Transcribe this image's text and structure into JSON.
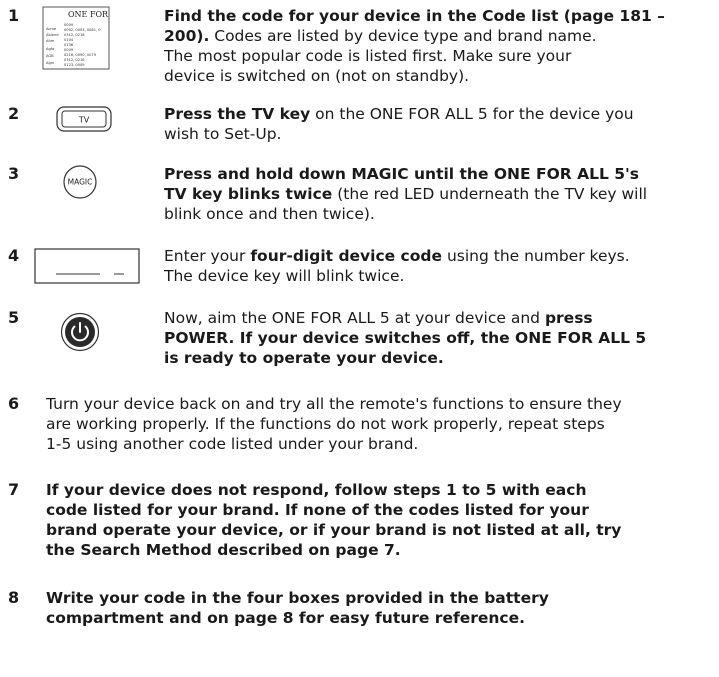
{
  "steps": [
    {
      "number": "1",
      "icon": "code-list-page-thumbnail",
      "thumbnail": {
        "heading": "ONE FOR",
        "brands": [
          "Acme",
          "Abiend",
          "Ahm",
          "Agfa",
          "AGB",
          "Agni"
        ],
        "codes": [
          "0009",
          "0002, 0093, 0081, 0",
          "0312, 0216",
          "0104",
          "0136",
          "0009",
          "0216, 0090, 0079",
          "0312, 0216",
          "0123, 0009"
        ]
      },
      "lines": [
        {
          "b": "Find the code for your device in the Code list (page 181 –"
        },
        {
          "b": "200).",
          "n": " Codes are listed by device type and brand name."
        },
        {
          "n": "The most popular code is listed first. Make sure your"
        },
        {
          "n": "device is switched on (not on standby)."
        }
      ]
    },
    {
      "number": "2",
      "icon": "tv-key-icon",
      "icon_label": "TV",
      "lines": [
        {
          "b": "Press the TV key",
          "n": " on the ONE FOR ALL 5 for the device you"
        },
        {
          "n": "wish to Set-Up."
        }
      ]
    },
    {
      "number": "3",
      "icon": "magic-key-icon",
      "icon_label": "MAGIC",
      "lines": [
        {
          "b": "Press and hold down MAGIC until the ONE FOR ALL 5's"
        },
        {
          "b": "TV key blinks twice",
          "n": " (the red LED underneath the TV key will"
        },
        {
          "n": "blink once and then twice)."
        }
      ]
    },
    {
      "number": "4",
      "icon": "code-entry-box-icon",
      "lines": [
        {
          "n": "Enter your ",
          "b": "four-digit device code",
          "n2": " using the number keys."
        },
        {
          "n": "The device key will blink twice."
        }
      ]
    },
    {
      "number": "5",
      "icon": "power-key-icon",
      "lines": [
        {
          "n": "Now, aim the ONE FOR ALL 5 at your device and ",
          "b": "press"
        },
        {
          "b": "POWER. If your device switches off, the ONE FOR ALL 5"
        },
        {
          "b": "is ready to operate your device."
        }
      ]
    },
    {
      "number": "6",
      "lines": [
        {
          "n": "Turn your device back on and try all the remote's functions to ensure they"
        },
        {
          "n": "are working properly. If the functions do not work properly, repeat steps"
        },
        {
          "n": "1-5 using another code listed under your brand."
        }
      ]
    },
    {
      "number": "7",
      "lines": [
        {
          "b": "If your device does not respond, follow steps 1 to 5 with each"
        },
        {
          "b": "code listed for your brand. If none of the codes listed for your"
        },
        {
          "b": "brand operate your device, or if your brand is not listed at all, try"
        },
        {
          "b": "the Search Method described on page 7."
        }
      ]
    },
    {
      "number": "8",
      "lines": [
        {
          "b": "Write your code in the four boxes provided in the battery"
        },
        {
          "b": "compartment and on page 8 for easy future reference."
        }
      ]
    }
  ]
}
